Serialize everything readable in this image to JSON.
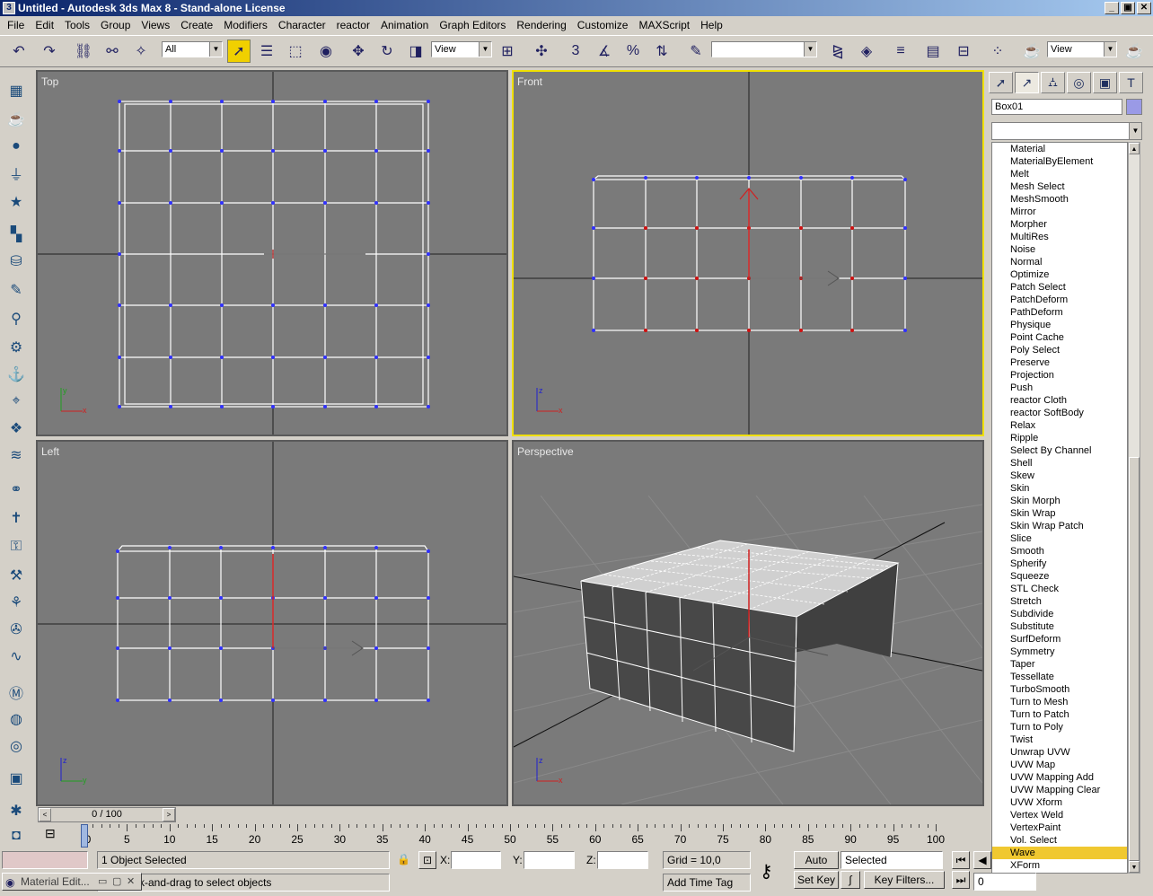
{
  "window": {
    "title": "Untitled - Autodesk 3ds Max 8 - Stand-alone License",
    "buttons": [
      "_",
      "▣",
      "✕"
    ]
  },
  "menu": [
    "File",
    "Edit",
    "Tools",
    "Group",
    "Views",
    "Create",
    "Modifiers",
    "Character",
    "reactor",
    "Animation",
    "Graph Editors",
    "Rendering",
    "Customize",
    "MAXScript",
    "Help"
  ],
  "toolbar": {
    "selection_filter": "All",
    "ref_coord": "View",
    "named_selection": "",
    "viewport_combo": "View",
    "percent_snap_label": "%",
    "angle_snap_label": "3"
  },
  "viewports": {
    "top": "Top",
    "front": "Front",
    "left": "Left",
    "perspective": "Perspective",
    "axis_labels": {
      "x": "x",
      "y": "y",
      "z": "z"
    }
  },
  "command_panel": {
    "object_name": "Box01",
    "object_color": "#9a9ae6",
    "modifier_list": "",
    "modifiers": [
      "Material",
      "MaterialByElement",
      "Melt",
      "Mesh Select",
      "MeshSmooth",
      "Mirror",
      "Morpher",
      "MultiRes",
      "Noise",
      "Normal",
      "Optimize",
      "Patch Select",
      "PatchDeform",
      "PathDeform",
      "Physique",
      "Point Cache",
      "Poly Select",
      "Preserve",
      "Projection",
      "Push",
      "reactor Cloth",
      "reactor SoftBody",
      "Relax",
      "Ripple",
      "Select By Channel",
      "Shell",
      "Skew",
      "Skin",
      "Skin Morph",
      "Skin Wrap",
      "Skin Wrap Patch",
      "Slice",
      "Smooth",
      "Spherify",
      "Squeeze",
      "STL Check",
      "Stretch",
      "Subdivide",
      "Substitute",
      "SurfDeform",
      "Symmetry",
      "Taper",
      "Tessellate",
      "TurboSmooth",
      "Turn to Mesh",
      "Turn to Patch",
      "Turn to Poly",
      "Twist",
      "Unwrap UVW",
      "UVW Map",
      "UVW Mapping Add",
      "UVW Mapping Clear",
      "UVW Xform",
      "Vertex Weld",
      "VertexPaint",
      "Vol. Select",
      "Wave",
      "XForm"
    ],
    "selected_modifier": "Wave"
  },
  "timeline": {
    "frame_display": "0 / 100",
    "ticks": [
      "0",
      "5",
      "10",
      "15",
      "20",
      "25",
      "30",
      "35",
      "40",
      "45",
      "50",
      "55",
      "60",
      "65",
      "70",
      "75",
      "80",
      "85",
      "90",
      "95",
      "100"
    ]
  },
  "status": {
    "selection": "1 Object Selected",
    "prompt": "ck-and-drag to select objects",
    "x_label": "X:",
    "y_label": "Y:",
    "z_label": "Z:",
    "x_value": "",
    "y_value": "",
    "z_value": "",
    "grid": "Grid = 10,0",
    "add_time_tag": "Add Time Tag",
    "auto_key": "Auto Key",
    "set_key": "Set Key",
    "key_mode": "Selected",
    "key_filters": "Key Filters...",
    "frame": "0"
  },
  "taskbar": {
    "minimized_window": "Material Edit..."
  }
}
